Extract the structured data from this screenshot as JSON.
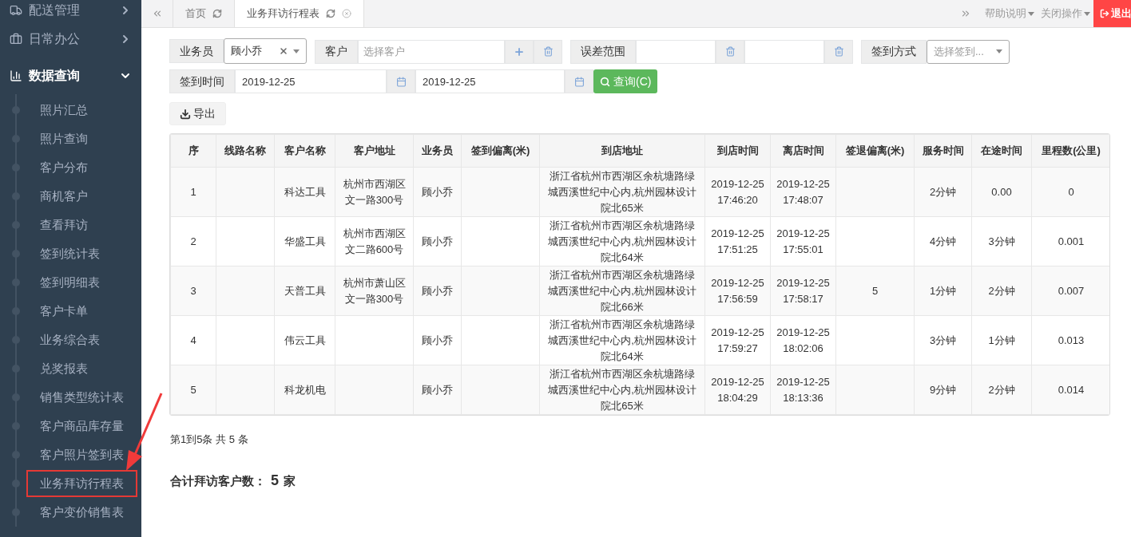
{
  "sidebar": {
    "items": [
      {
        "label": "配送管理",
        "expanded": false
      },
      {
        "label": "日常办公",
        "expanded": false
      },
      {
        "label": "数据查询",
        "expanded": true,
        "children": [
          {
            "label": "照片汇总",
            "selected": false
          },
          {
            "label": "照片查询",
            "selected": false
          },
          {
            "label": "客户分布",
            "selected": false
          },
          {
            "label": "商机客户",
            "selected": false
          },
          {
            "label": "查看拜访",
            "selected": false
          },
          {
            "label": "签到统计表",
            "selected": false
          },
          {
            "label": "签到明细表",
            "selected": false
          },
          {
            "label": "客户卡单",
            "selected": false
          },
          {
            "label": "业务综合表",
            "selected": false
          },
          {
            "label": "兑奖报表",
            "selected": false
          },
          {
            "label": "销售类型统计表",
            "selected": false
          },
          {
            "label": "客户商品库存量",
            "selected": false
          },
          {
            "label": "客户照片签到表",
            "selected": false
          },
          {
            "label": "业务拜访行程表",
            "selected": true
          },
          {
            "label": "客户变价销售表",
            "selected": false
          }
        ]
      }
    ]
  },
  "tabs": [
    {
      "label": "首页",
      "selected": false
    },
    {
      "label": "业务拜访行程表",
      "selected": true
    }
  ],
  "top_menu": {
    "help": "帮助说明",
    "close_ops": "关闭操作",
    "logout": "退出"
  },
  "filters": {
    "salesperson": {
      "label": "业务员",
      "value": "顾小乔"
    },
    "customer": {
      "label": "客户",
      "placeholder": "选择客户"
    },
    "error_range": {
      "label": "误差范围"
    },
    "sign_method": {
      "label": "签到方式",
      "placeholder": "选择签到..."
    },
    "sign_time": {
      "label": "签到时间",
      "from": "2019-12-25",
      "to": "2019-12-25"
    },
    "query_button": "查询(C)"
  },
  "export_button": "导出",
  "table": {
    "columns": [
      "序",
      "线路名称",
      "客户名称",
      "客户地址",
      "业务员",
      "签到偏离(米)",
      "到店地址",
      "到店时间",
      "离店时间",
      "签退偏离(米)",
      "服务时间",
      "在途时间",
      "里程数(公里)"
    ],
    "rows": [
      [
        "1",
        "",
        "科达工具",
        "杭州市西湖区文一路300号",
        "顾小乔",
        "",
        "浙江省杭州市西湖区余杭塘路绿城西溪世纪中心内,杭州园林设计院北65米",
        "2019-12-25 17:46:20",
        "2019-12-25 17:48:07",
        "",
        "2分钟",
        "0.00",
        "0"
      ],
      [
        "2",
        "",
        "华盛工具",
        "杭州市西湖区文二路600号",
        "顾小乔",
        "",
        "浙江省杭州市西湖区余杭塘路绿城西溪世纪中心内,杭州园林设计院北64米",
        "2019-12-25 17:51:25",
        "2019-12-25 17:55:01",
        "",
        "4分钟",
        "3分钟",
        "0.001"
      ],
      [
        "3",
        "",
        "天普工具",
        "杭州市萧山区文一路300号",
        "顾小乔",
        "",
        "浙江省杭州市西湖区余杭塘路绿城西溪世纪中心内,杭州园林设计院北66米",
        "2019-12-25 17:56:59",
        "2019-12-25 17:58:17",
        "5",
        "1分钟",
        "2分钟",
        "0.007"
      ],
      [
        "4",
        "",
        "伟云工具",
        "",
        "顾小乔",
        "",
        "浙江省杭州市西湖区余杭塘路绿城西溪世纪中心内,杭州园林设计院北64米",
        "2019-12-25 17:59:27",
        "2019-12-25 18:02:06",
        "",
        "3分钟",
        "1分钟",
        "0.013"
      ],
      [
        "5",
        "",
        "科龙机电",
        "",
        "顾小乔",
        "",
        "浙江省杭州市西湖区余杭塘路绿城西溪世纪中心内,杭州园林设计院北65米",
        "2019-12-25 18:04:29",
        "2019-12-25 18:13:36",
        "",
        "9分钟",
        "2分钟",
        "0.014"
      ]
    ]
  },
  "pagination": "第1到5条 共 5 条",
  "summary": {
    "label": "合计拜访客户数：",
    "count": "5",
    "unit": "家"
  }
}
